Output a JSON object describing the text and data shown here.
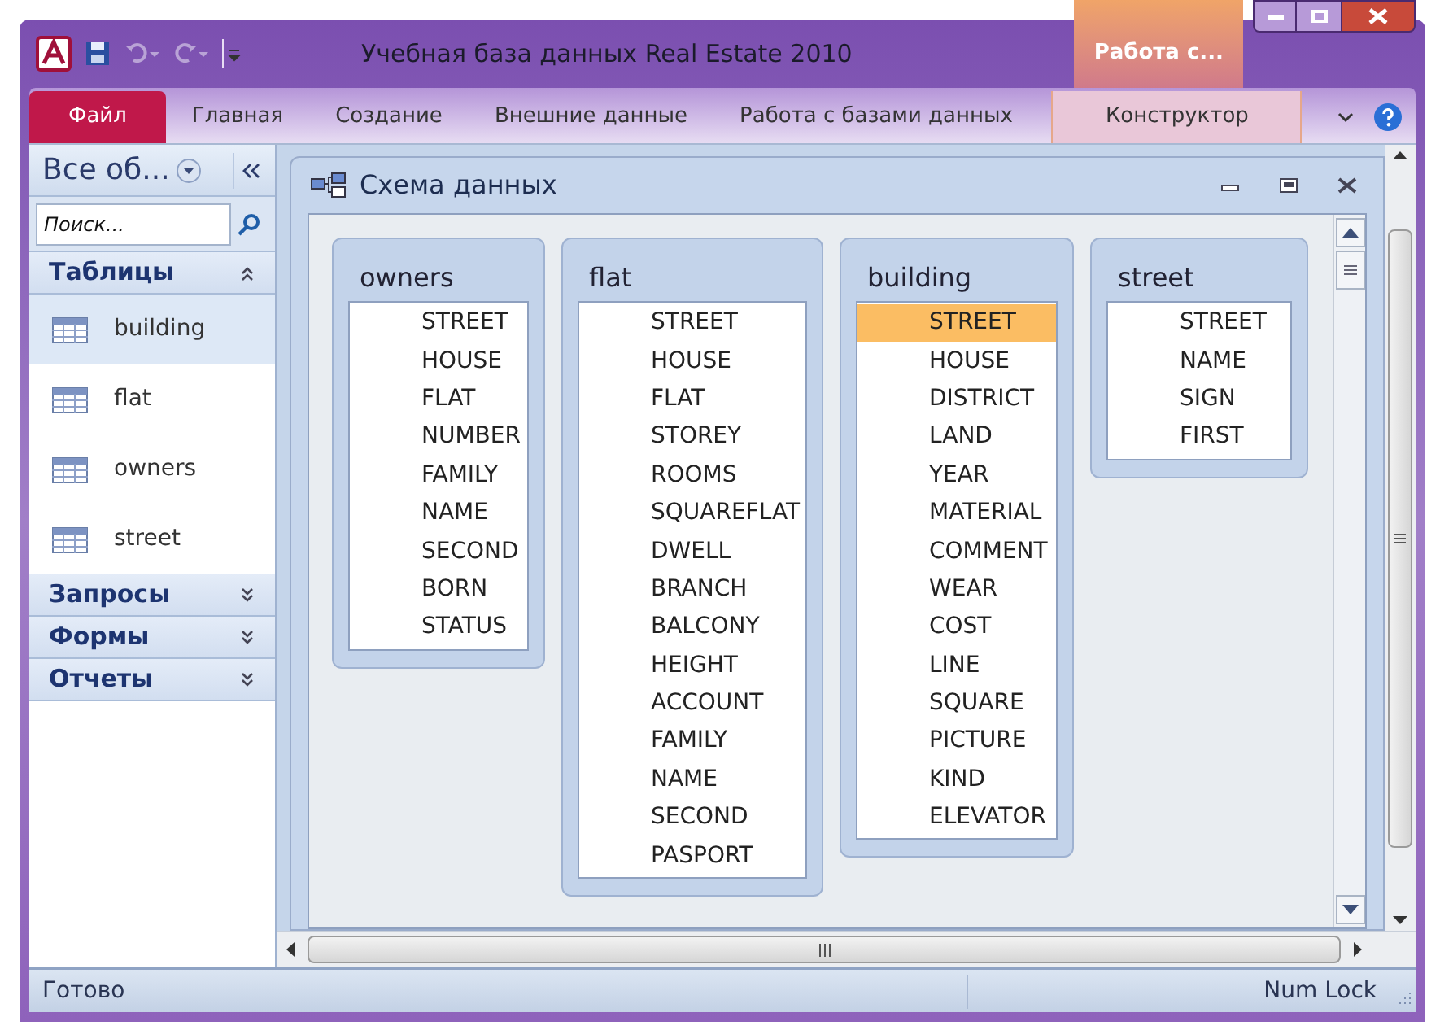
{
  "window": {
    "title": "Учебная база данных Real Estate 2010",
    "context_tab": "Работа с..."
  },
  "ribbon_tabs": [
    {
      "label": "Файл",
      "selected": true,
      "kind": "file"
    },
    {
      "label": "Главная",
      "selected": false,
      "kind": "normal"
    },
    {
      "label": "Создание",
      "selected": false,
      "kind": "normal"
    },
    {
      "label": "Внешние данные",
      "selected": false,
      "kind": "normal"
    },
    {
      "label": "Работа с базами данных",
      "selected": false,
      "kind": "normal"
    },
    {
      "label": "Конструктор",
      "selected": false,
      "kind": "context"
    }
  ],
  "nav_pane": {
    "title": "Все об...",
    "search": {
      "placeholder": "Поиск..."
    },
    "groups": [
      {
        "label": "Таблицы",
        "expanded": true,
        "items": [
          {
            "label": "building",
            "selected": true
          },
          {
            "label": "flat",
            "selected": false
          },
          {
            "label": "owners",
            "selected": false
          },
          {
            "label": "street",
            "selected": false
          }
        ]
      },
      {
        "label": "Запросы",
        "expanded": false
      },
      {
        "label": "Формы",
        "expanded": false
      },
      {
        "label": "Отчеты",
        "expanded": false
      }
    ]
  },
  "document": {
    "title": "Схема данных",
    "tables": [
      {
        "name": "owners",
        "fields": [
          {
            "label": "STREET",
            "selected": false
          },
          {
            "label": "HOUSE",
            "selected": false
          },
          {
            "label": "FLAT",
            "selected": false
          },
          {
            "label": "NUMBER",
            "selected": false
          },
          {
            "label": "FAMILY",
            "selected": false
          },
          {
            "label": "NAME",
            "selected": false
          },
          {
            "label": "SECOND",
            "selected": false
          },
          {
            "label": "BORN",
            "selected": false
          },
          {
            "label": "STATUS",
            "selected": false
          }
        ]
      },
      {
        "name": "flat",
        "fields": [
          {
            "label": "STREET",
            "selected": false
          },
          {
            "label": "HOUSE",
            "selected": false
          },
          {
            "label": "FLAT",
            "selected": false
          },
          {
            "label": "STOREY",
            "selected": false
          },
          {
            "label": "ROOMS",
            "selected": false
          },
          {
            "label": "SQUAREFLAT",
            "selected": false
          },
          {
            "label": "DWELL",
            "selected": false
          },
          {
            "label": "BRANCH",
            "selected": false
          },
          {
            "label": "BALCONY",
            "selected": false
          },
          {
            "label": "HEIGHT",
            "selected": false
          },
          {
            "label": "ACCOUNT",
            "selected": false
          },
          {
            "label": "FAMILY",
            "selected": false
          },
          {
            "label": "NAME",
            "selected": false
          },
          {
            "label": "SECOND",
            "selected": false
          },
          {
            "label": "PASPORT",
            "selected": false
          }
        ]
      },
      {
        "name": "building",
        "fields": [
          {
            "label": "STREET",
            "selected": true
          },
          {
            "label": "HOUSE",
            "selected": false
          },
          {
            "label": "DISTRICT",
            "selected": false
          },
          {
            "label": "LAND",
            "selected": false
          },
          {
            "label": "YEAR",
            "selected": false
          },
          {
            "label": "MATERIAL",
            "selected": false
          },
          {
            "label": "COMMENT",
            "selected": false
          },
          {
            "label": "WEAR",
            "selected": false
          },
          {
            "label": "COST",
            "selected": false
          },
          {
            "label": "LINE",
            "selected": false
          },
          {
            "label": "SQUARE",
            "selected": false
          },
          {
            "label": "PICTURE",
            "selected": false
          },
          {
            "label": "KIND",
            "selected": false
          },
          {
            "label": "ELEVATOR",
            "selected": false
          }
        ]
      },
      {
        "name": "street",
        "fields": [
          {
            "label": "STREET",
            "selected": false
          },
          {
            "label": "NAME",
            "selected": false
          },
          {
            "label": "SIGN",
            "selected": false
          },
          {
            "label": "FIRST",
            "selected": false
          }
        ]
      }
    ]
  },
  "status_bar": {
    "left": "Готово",
    "right": "Num Lock"
  }
}
